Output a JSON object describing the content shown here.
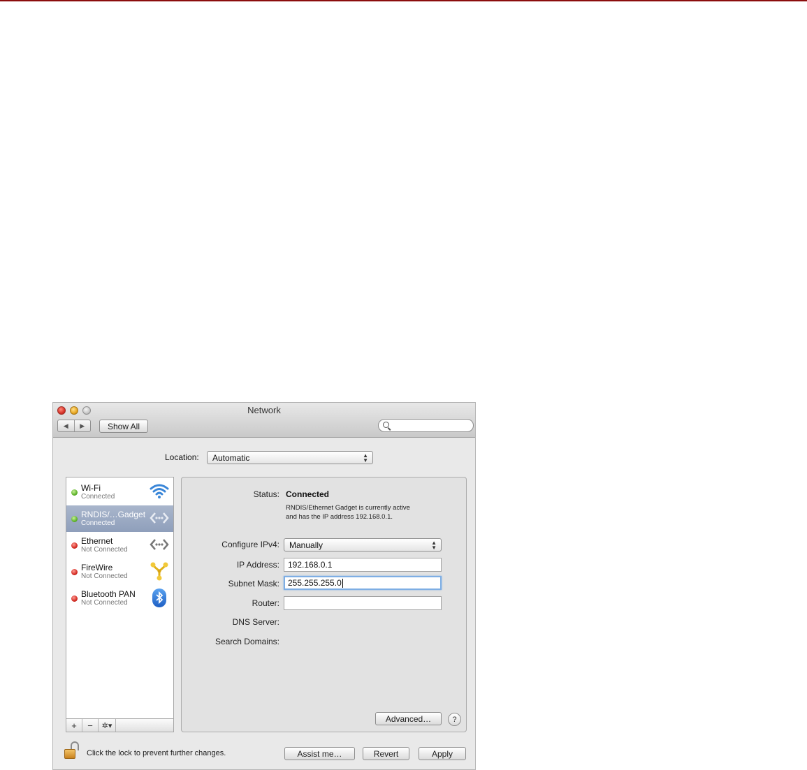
{
  "window": {
    "title": "Network"
  },
  "toolbar": {
    "back_glyph": "◀",
    "forward_glyph": "▶",
    "show_all_label": "Show All",
    "search_placeholder": ""
  },
  "location": {
    "label": "Location:",
    "value": "Automatic"
  },
  "services": [
    {
      "name": "Wi-Fi",
      "status": "Connected",
      "status_color": "green",
      "icon": "wifi-icon",
      "selected": false
    },
    {
      "name": "RNDIS/…Gadget",
      "status": "Connected",
      "status_color": "green",
      "icon": "ethernet-icon",
      "selected": true
    },
    {
      "name": "Ethernet",
      "status": "Not Connected",
      "status_color": "red",
      "icon": "ethernet-icon",
      "selected": false
    },
    {
      "name": "FireWire",
      "status": "Not Connected",
      "status_color": "red",
      "icon": "firewire-icon",
      "selected": false
    },
    {
      "name": "Bluetooth PAN",
      "status": "Not Connected",
      "status_color": "red",
      "icon": "bluetooth-icon",
      "selected": false
    }
  ],
  "sidebar_toolbar": {
    "add": "+",
    "remove": "−",
    "gear": "✲▾"
  },
  "detail": {
    "status_label": "Status:",
    "status_value": "Connected",
    "status_description_lines": [
      "RNDIS/Ethernet Gadget is currently active",
      "and has the IP address 192.168.0.1."
    ],
    "configure_label": "Configure IPv4:",
    "configure_value": "Manually",
    "ip_label": "IP Address:",
    "ip_value": "192.168.0.1",
    "subnet_label": "Subnet Mask:",
    "subnet_value": "255.255.255.0",
    "router_label": "Router:",
    "router_value": "",
    "dns_label": "DNS Server:",
    "search_domains_label": "Search Domains:",
    "advanced_label": "Advanced…",
    "help_label": "?"
  },
  "footer": {
    "lock_text": "Click the lock to prevent further changes.",
    "assist_label": "Assist me…",
    "revert_label": "Revert",
    "apply_label": "Apply"
  },
  "colors": {
    "accent_top_line": "#8b0d0d",
    "selection": "#97a6c1",
    "status_green": "#5db22a",
    "status_red": "#d22a22",
    "focus_ring": "#7eaee4"
  }
}
